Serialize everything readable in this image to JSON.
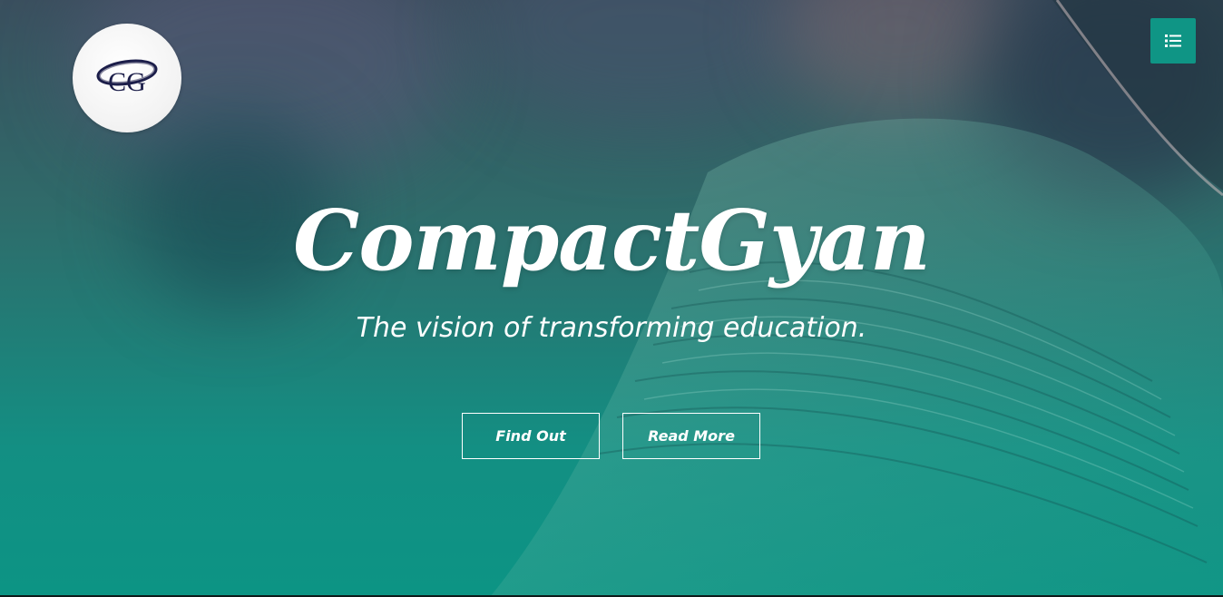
{
  "logo": {
    "text": "CG",
    "color": "#1c1e4a"
  },
  "menu": {
    "icon": "list-icon",
    "color": "#0f9585"
  },
  "hero": {
    "title": "CompactGyan",
    "subtitle": "The vision of transforming education.",
    "buttons": [
      {
        "label": "Find Out"
      },
      {
        "label": "Read More"
      }
    ]
  },
  "colors": {
    "accent": "#0f9585",
    "overlay_top": "#3a4f5e",
    "overlay_bottom": "#0c9484"
  }
}
